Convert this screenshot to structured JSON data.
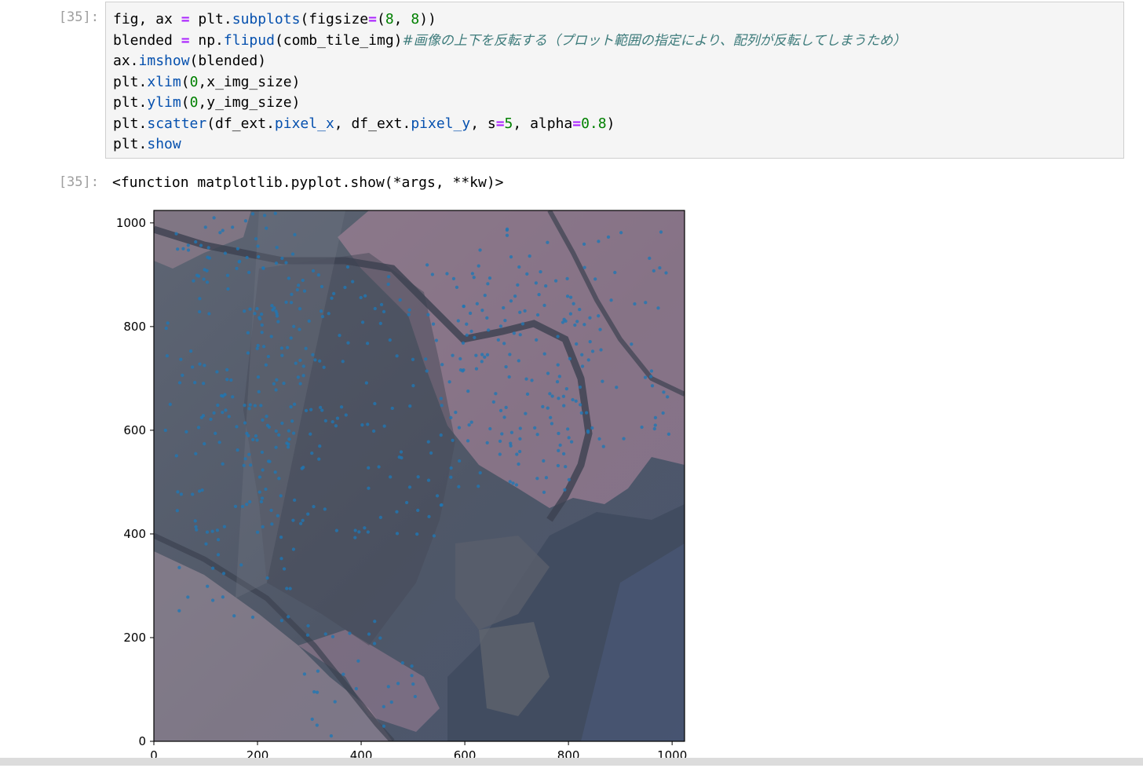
{
  "input_cell": {
    "prompt": "[35]:",
    "code_lines": [
      [
        [
          "fig, ax ",
          ""
        ],
        [
          "=",
          "op"
        ],
        [
          " plt.",
          ""
        ],
        [
          "subplots",
          "attr"
        ],
        [
          "(figsize",
          ""
        ],
        [
          "=",
          "op"
        ],
        [
          "(",
          ""
        ],
        [
          "8",
          "num"
        ],
        [
          ", ",
          ""
        ],
        [
          "8",
          "num"
        ],
        [
          "))",
          ""
        ]
      ],
      [
        [
          "blended ",
          ""
        ],
        [
          "=",
          "op"
        ],
        [
          " np.",
          ""
        ],
        [
          "flipud",
          "attr"
        ],
        [
          "(comb_tile_img)",
          ""
        ],
        [
          "#画像の上下を反転する（プロット範囲の指定により、配列が反転してしまうため）",
          "cmt"
        ]
      ],
      [
        [
          "ax.",
          ""
        ],
        [
          "imshow",
          "attr"
        ],
        [
          "(blended)",
          ""
        ]
      ],
      [
        [
          "plt.",
          ""
        ],
        [
          "xlim",
          "attr"
        ],
        [
          "(",
          ""
        ],
        [
          "0",
          "num"
        ],
        [
          ",x_img_size)",
          ""
        ]
      ],
      [
        [
          "plt.",
          ""
        ],
        [
          "ylim",
          "attr"
        ],
        [
          "(",
          ""
        ],
        [
          "0",
          "num"
        ],
        [
          ",y_img_size)",
          ""
        ]
      ],
      [
        [
          "plt.",
          ""
        ],
        [
          "scatter",
          "attr"
        ],
        [
          "(df_ext.",
          ""
        ],
        [
          "pixel_x",
          "attr"
        ],
        [
          ", df_ext.",
          ""
        ],
        [
          "pixel_y",
          "attr"
        ],
        [
          ", s",
          ""
        ],
        [
          "=",
          "op"
        ],
        [
          "5",
          "num"
        ],
        [
          ", alpha",
          ""
        ],
        [
          "=",
          "op"
        ],
        [
          "0.8",
          "num"
        ],
        [
          ")",
          ""
        ]
      ],
      [
        [
          "plt.",
          ""
        ],
        [
          "show",
          "attr"
        ]
      ]
    ]
  },
  "output_cell": {
    "prompt": "[35]:",
    "text": "<function matplotlib.pyplot.show(*args, **kw)>"
  },
  "chart_data": {
    "type": "scatter",
    "title": "",
    "xlabel": "",
    "ylabel": "",
    "xlim": [
      0,
      1024
    ],
    "ylim": [
      0,
      1024
    ],
    "xticks": [
      0,
      200,
      400,
      600,
      800,
      1000
    ],
    "yticks": [
      0,
      200,
      400,
      600,
      800,
      1000
    ],
    "background": "aerial image (blended satellite tile)",
    "marker_color": "#1f77b4",
    "marker_size": 5,
    "alpha": 0.8,
    "grid": false,
    "legend": "none",
    "clusters": [
      {
        "x": [
          20,
          290
        ],
        "y": [
          400,
          1020
        ],
        "density": 0.55
      },
      {
        "x": [
          80,
          330
        ],
        "y": [
          560,
          960
        ],
        "density": 0.35
      },
      {
        "x": [
          180,
          570
        ],
        "y": [
          390,
          920
        ],
        "density": 0.45
      },
      {
        "x": [
          570,
          820
        ],
        "y": [
          480,
          930
        ],
        "density": 0.7
      },
      {
        "x": [
          600,
          990
        ],
        "y": [
          560,
          1000
        ],
        "density": 0.35
      },
      {
        "x": [
          290,
          520
        ],
        "y": [
          10,
          240
        ],
        "density": 0.4
      },
      {
        "x": [
          0,
          280
        ],
        "y": [
          220,
          480
        ],
        "density": 0.3
      },
      {
        "x": [
          820,
          1000
        ],
        "y": [
          560,
          700
        ],
        "density": 0.3
      }
    ]
  }
}
